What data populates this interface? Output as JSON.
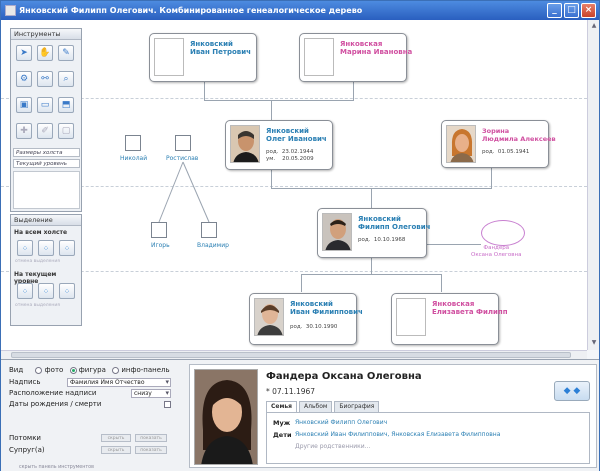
{
  "window": {
    "title": "Янковский Филипп Олегович. Комбинированное генеалогическое дерево",
    "controls": [
      "_",
      "□",
      "×"
    ]
  },
  "tools_panel": {
    "title": "Инструменты",
    "canvas_size_label": "Размеры холста",
    "current_level_label": "Текущий уровень"
  },
  "selection_panel": {
    "title": "Выделение",
    "on_canvas": "На всем холсте",
    "on_level": "На текущем уровне",
    "hint": "отмена выделения"
  },
  "tree": {
    "row1": [
      {
        "name": "Янковский\nИван Петрович",
        "dates": ""
      },
      {
        "name": "Янковская\nМарина Ивановна",
        "dates": ""
      }
    ],
    "row2": [
      {
        "name": "Янковский\nОлег Иванович",
        "dates": "род.  23.02.1944\nум.    20.05.2009"
      },
      {
        "name": "Зорина\nЛюдмила Алексеев",
        "dates": "род.  01.05.1941"
      }
    ],
    "row3": {
      "name": "Янковский\nФилипп Олегович",
      "dates": "род.  10.10.1968"
    },
    "row4": [
      {
        "name": "Янковский\nИван Филиппович",
        "dates": "род.  30.10.1990"
      },
      {
        "name": "Янковская\nЕлизавета Филипп",
        "dates": ""
      }
    ],
    "small": [
      "Николай",
      "Ростислав",
      "Игорь",
      "Владимир"
    ],
    "oval_label": "Фандера\nОксана Олеговна"
  },
  "settings": {
    "view_label": "Вид",
    "view_options": [
      "фото",
      "фигура",
      "инфо-панель"
    ],
    "caption_label": "Надпись",
    "caption_value": "Фамилия Имя Отчество",
    "caption_pos_label": "Расположение надписи",
    "caption_pos_value": "снизу",
    "dates_label": "Даты рождения / смерти",
    "descendants_label": "Потомки",
    "spouses_label": "Супруг(а)",
    "btn_hide": "скрыть",
    "btn_show": "показать",
    "hide_panel": "скрыть панель инструментов"
  },
  "card": {
    "name": "Фандера Оксана Олеговна",
    "birth": "* 07.11.1967",
    "tabs": [
      "Семья",
      "Альбом",
      "Биография"
    ],
    "husband_label": "Муж",
    "husband": "Янковский Филипп Олегович",
    "children_label": "Дети",
    "children": "Янковский Иван Филиппович, Янковская Елизавета Филипповна",
    "other": "Другие родственники..."
  },
  "colors": {
    "male": "#2a7fb3",
    "female": "#d04fa0",
    "title_bar": "#2a5fbf"
  }
}
